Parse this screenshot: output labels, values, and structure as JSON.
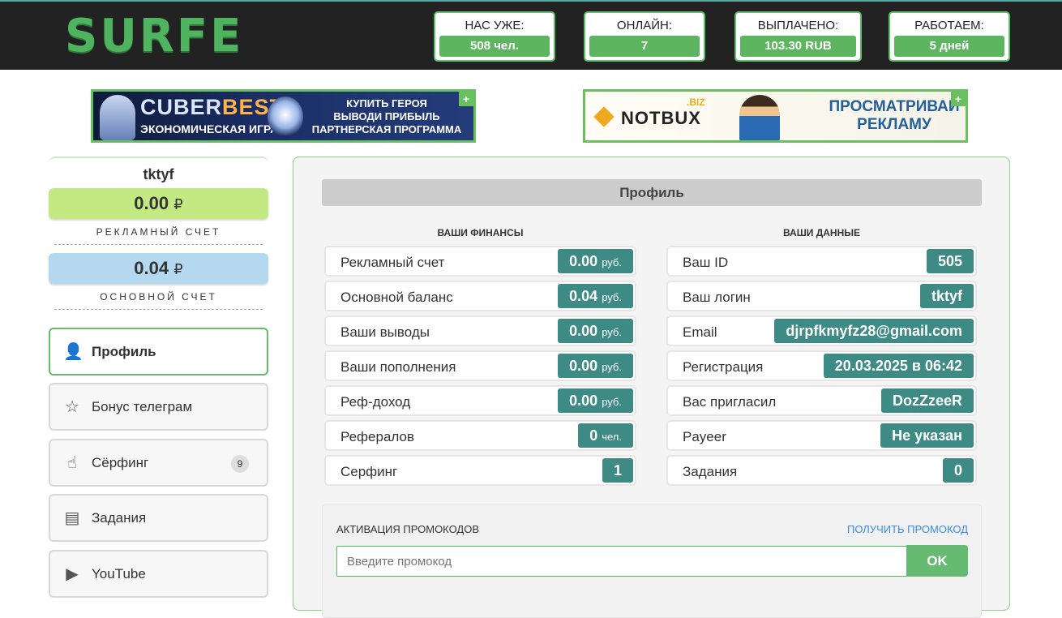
{
  "header": {
    "logo": "SURFE",
    "stats": [
      {
        "label": "НАС УЖЕ:",
        "value": "508 чел."
      },
      {
        "label": "ОНЛАЙН:",
        "value": "7"
      },
      {
        "label": "ВЫПЛАЧЕНО:",
        "value": "103.30 RUB"
      },
      {
        "label": "РАБОТАЕМ:",
        "value": "5 дней"
      }
    ]
  },
  "banners": {
    "cuberbest": {
      "brand_a": "CUBER",
      "brand_b": "BEST",
      "tagline": "ЭКОНОМИЧЕСКАЯ ИГРА",
      "lines": [
        "КУПИТЬ ГЕРОЯ",
        "ВЫВОДИ ПРИБЫЛЬ",
        "ПАРТНЕРСКАЯ ПРОГРАММА"
      ],
      "plus": "+"
    },
    "notbux": {
      "brand": "NOTBUX",
      "suffix": ".BIZ",
      "lines": [
        "ПРОСМАТРИВАЙ",
        "РЕКЛАМУ"
      ],
      "plus": "+"
    }
  },
  "sidebar": {
    "username": "tktyf",
    "ad_balance": {
      "amount": "0.00",
      "currency": "₽",
      "label": "РЕКЛАМНЫЙ СЧЕТ"
    },
    "main_balance": {
      "amount": "0.04",
      "currency": "₽",
      "label": "ОСНОВНОЙ СЧЕТ"
    },
    "nav": [
      {
        "label": "Профиль",
        "icon": "user-icon",
        "glyph": "👤"
      },
      {
        "label": "Бонус телеграм",
        "icon": "star-icon",
        "glyph": "☆"
      },
      {
        "label": "Сёрфинг",
        "icon": "hand-pointer-icon",
        "glyph": "☝",
        "badge": "9"
      },
      {
        "label": "Задания",
        "icon": "book-icon",
        "glyph": "▤"
      },
      {
        "label": "YouTube",
        "icon": "youtube-icon",
        "glyph": "▶"
      }
    ]
  },
  "main": {
    "title": "Профиль",
    "finances_header": "ВАШИ ФИНАНСЫ",
    "data_header": "ВАШИ ДАННЫЕ",
    "finances": [
      {
        "label": "Рекламный счет",
        "value": "0.00",
        "unit": "руб."
      },
      {
        "label": "Основной баланс",
        "value": "0.04",
        "unit": "руб."
      },
      {
        "label": "Ваши выводы",
        "value": "0.00",
        "unit": "руб."
      },
      {
        "label": "Ваши пополнения",
        "value": "0.00",
        "unit": "руб."
      },
      {
        "label": "Реф-доход",
        "value": "0.00",
        "unit": "руб."
      },
      {
        "label": "Рефералов",
        "value": "0",
        "unit": "чел."
      },
      {
        "label": "Серфинг",
        "value": "1",
        "unit": ""
      }
    ],
    "data": [
      {
        "label": "Ваш ID",
        "value": "505"
      },
      {
        "label": "Ваш логин",
        "value": "tktyf"
      },
      {
        "label": "Email",
        "value": "djrpfkmyfz28@gmail.com"
      },
      {
        "label": "Регистрация",
        "value": "20.03.2025 в 06:42"
      },
      {
        "label": "Вас пригласил",
        "value": "DozZzeeR"
      },
      {
        "label": "Payeer",
        "value": "Не указан"
      },
      {
        "label": "Задания",
        "value": "0"
      }
    ],
    "promo": {
      "label": "АКТИВАЦИЯ ПРОМОКОДОВ",
      "link": "ПОЛУЧИТЬ ПРОМОКОД",
      "placeholder": "Введите промокод",
      "button": "OK"
    }
  },
  "colors": {
    "header_bg": "#222222",
    "accent_green": "#5db55f",
    "teal_value": "#3e8a85",
    "ad_balance_bg": "#c3e983",
    "main_balance_bg": "#b4d8ef",
    "link_blue": "#3a8be0"
  }
}
